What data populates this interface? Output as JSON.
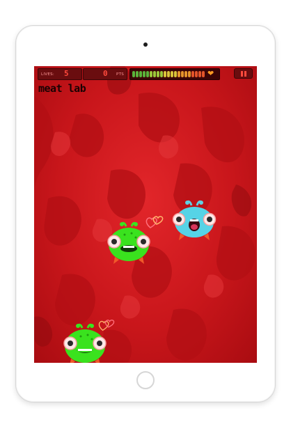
{
  "hud": {
    "lives_label": "LIVES:",
    "lives_value": "5",
    "points_value": "0",
    "points_label": "PTS",
    "meter_level": 1.0,
    "meter_colors": [
      "#5ab33a",
      "#9cc83a",
      "#d9c43a",
      "#e7952c",
      "#e3542a"
    ]
  },
  "level": {
    "title": "meat lab"
  },
  "colors": {
    "meat_red": "#c9161b",
    "hud_panel": "#6a0d0f",
    "hud_text": "#ff4a3d",
    "green_creature": "#39e51f",
    "blue_creature": "#55d3e4"
  },
  "icons": [
    "camera-icon",
    "home-button",
    "pause-icon",
    "heart-icon"
  ]
}
